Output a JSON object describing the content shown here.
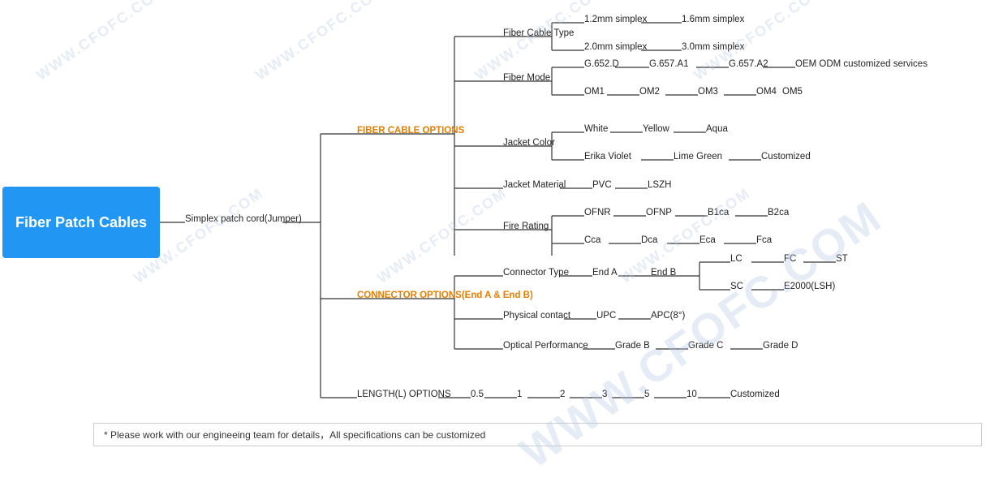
{
  "root": {
    "label": "Fiber Patch Cables"
  },
  "footer": "* Please work with our engineeing team for details，All specifications can be customized",
  "watermarks": [
    "WWW.CFOFC.COM",
    "WWW.CFOFC.COM",
    "WWW.CFOFC.COM",
    "WWW.CFOFC.COM",
    "WWW.CFOFC.COM",
    "WWW.CFOFC.COM"
  ],
  "nodes": {
    "simplex": "Simplex patch cord(Jumper)",
    "fiber_cable_options": "FIBER CABLE OPTIONS",
    "connector_options": "CONNECTOR OPTIONS(End A & End B)",
    "length_options": "LENGTH(L) OPTIONS",
    "fiber_cable_type": "Fiber Cable Type",
    "fiber_mode": "Fiber Mode",
    "jacket_color": "Jacket Color",
    "jacket_material": "Jacket Material",
    "fire_rating": "Fire Rating",
    "connector_type": "Connector Type",
    "physical_contact": "Physical contact",
    "optical_performance": "Optical Performance",
    "simplex_1_2": "1.2mm simplex",
    "simplex_1_6": "1.6mm simplex",
    "simplex_2_0": "2.0mm simplex",
    "simplex_3_0": "3.0mm simplex",
    "g652d": "G.652.D",
    "g657a1": "G.657.A1",
    "g657a2": "G.657.A2",
    "oem_odm": "OEM ODM customized services",
    "om1": "OM1",
    "om2": "OM2",
    "om3": "OM3",
    "om4": "OM4",
    "om5": "OM5",
    "white": "White",
    "yellow": "Yellow",
    "aqua": "Aqua",
    "erika_violet": "Erika Violet",
    "lime_green": "Lime Green",
    "customized_color": "Customized",
    "pvc": "PVC",
    "lszh": "LSZH",
    "ofnr": "OFNR",
    "ofnp": "OFNP",
    "b1ca": "B1ca",
    "b2ca": "B2ca",
    "cca": "Cca",
    "dca": "Dca",
    "eca": "Eca",
    "fca": "Fca",
    "end_a": "End A",
    "end_b": "End B",
    "lc": "LC",
    "fc": "FC",
    "st": "ST",
    "sc": "SC",
    "e2000": "E2000(LSH)",
    "upc": "UPC",
    "apc": "APC(8°)",
    "grade_b": "Grade B",
    "grade_c": "Grade C",
    "grade_d": "Grade D",
    "len_0_5": "0.5",
    "len_1": "1",
    "len_2": "2",
    "len_3": "3",
    "len_5": "5",
    "len_10": "10",
    "customized_len": "Customized"
  }
}
